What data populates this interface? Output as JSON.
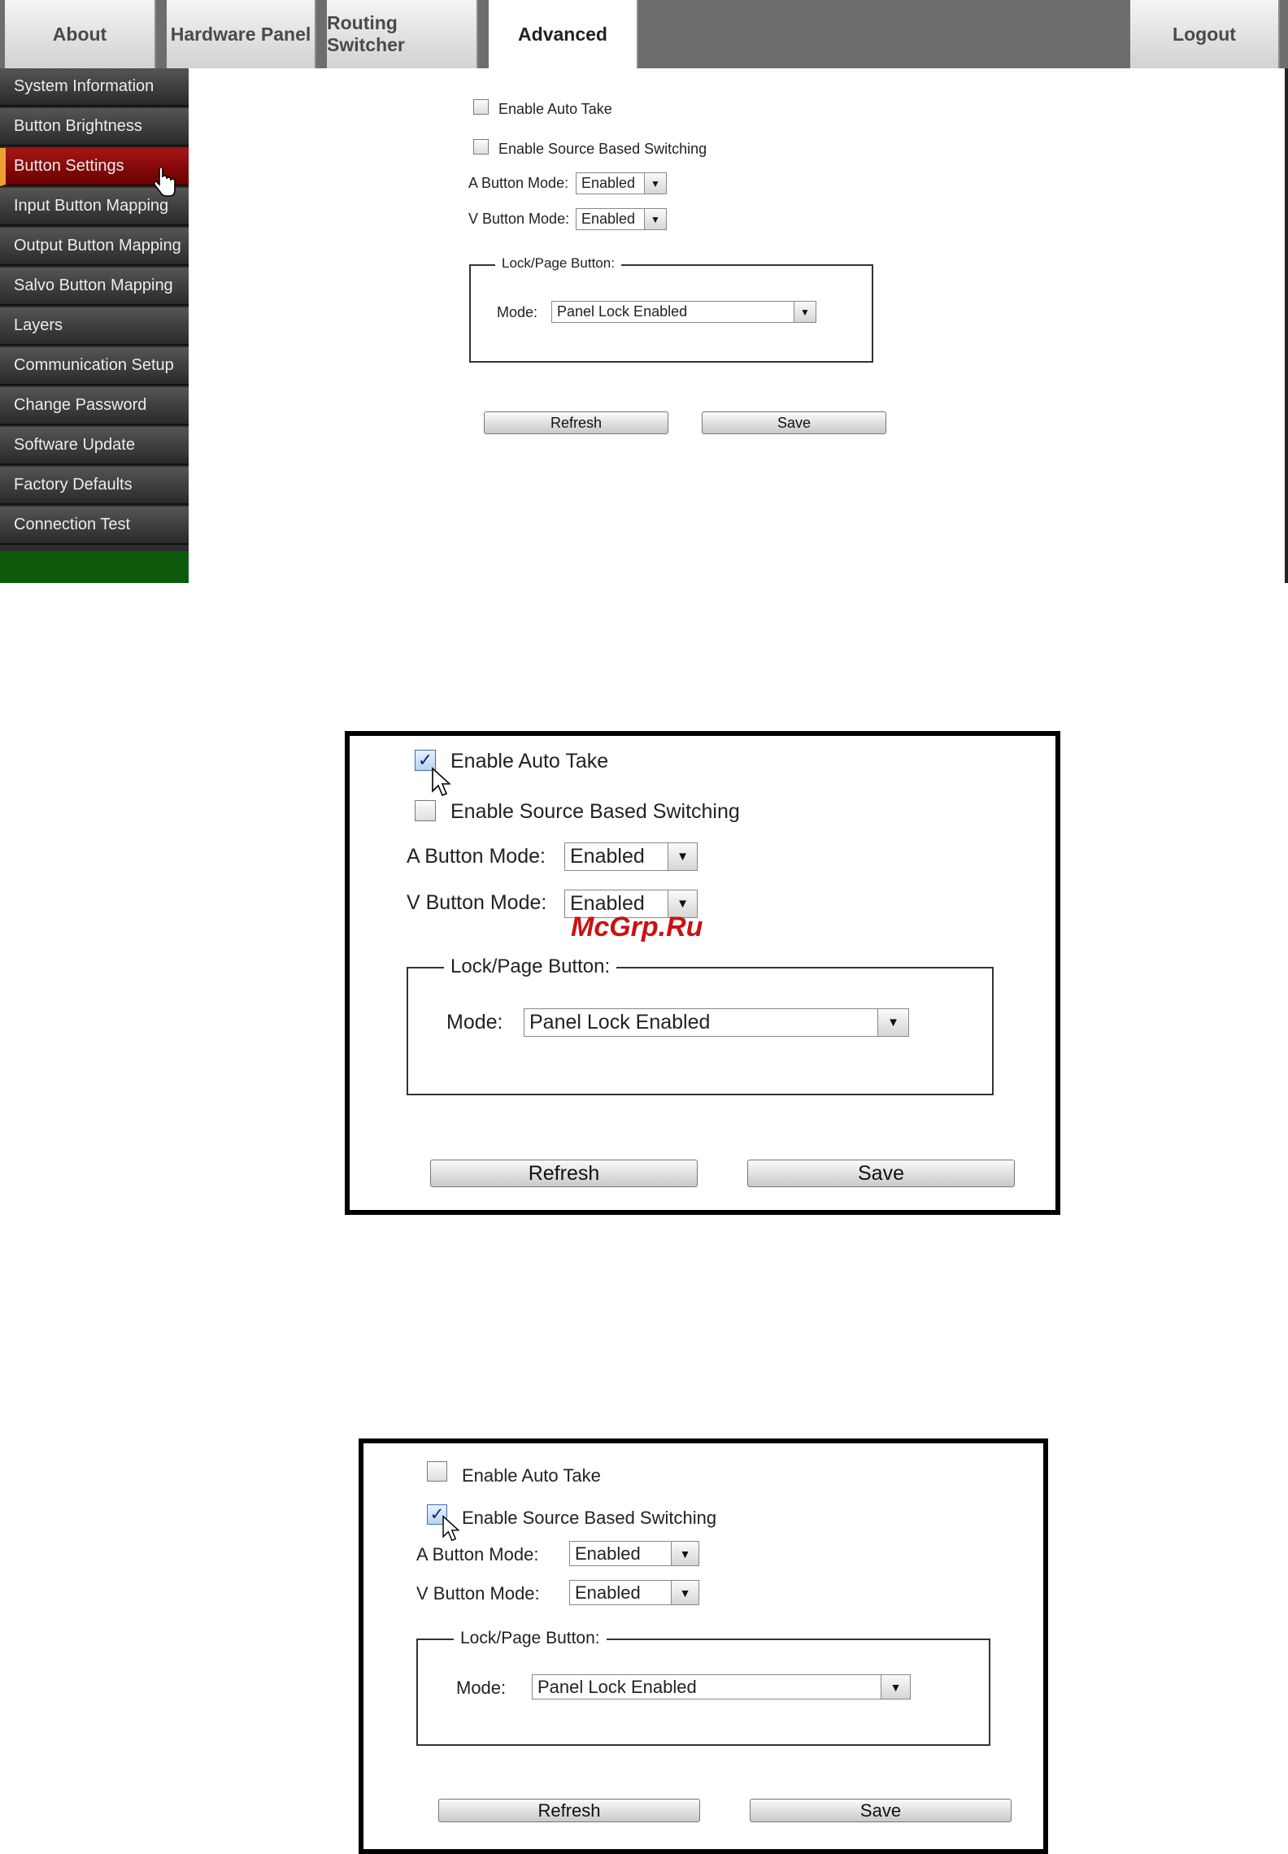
{
  "tabs": {
    "about": "About",
    "hardware_panel": "Hardware Panel",
    "routing_switcher": "Routing Switcher",
    "advanced": "Advanced",
    "logout": "Logout"
  },
  "sidebar": {
    "items": [
      {
        "label": "System Information"
      },
      {
        "label": "Button Brightness"
      },
      {
        "label": "Button Settings"
      },
      {
        "label": "Input Button Mapping"
      },
      {
        "label": "Output Button Mapping"
      },
      {
        "label": "Salvo Button Mapping"
      },
      {
        "label": "Layers"
      },
      {
        "label": "Communication Setup"
      },
      {
        "label": "Change Password"
      },
      {
        "label": "Software Update"
      },
      {
        "label": "Factory Defaults"
      },
      {
        "label": "Connection Test"
      }
    ],
    "active_item": "Button Settings"
  },
  "form": {
    "auto_take_label": "Enable Auto Take",
    "source_switching_label": "Enable Source Based Switching",
    "a_mode_label": "A Button Mode:",
    "a_mode_value": "Enabled",
    "v_mode_label": "V Button Mode:",
    "v_mode_value": "Enabled",
    "lock_legend": "Lock/Page Button:",
    "mode_label": "Mode:",
    "mode_value": "Panel Lock Enabled",
    "refresh_label": "Refresh",
    "save_label": "Save"
  },
  "panels": {
    "main": {
      "auto_take_checked": false,
      "source_switching_checked": false
    },
    "example_auto_take": {
      "auto_take_checked": true,
      "source_switching_checked": false
    },
    "example_source_switching": {
      "auto_take_checked": false,
      "source_switching_checked": true
    }
  },
  "watermark": "McGrp.Ru",
  "colors": {
    "active_tab_bg": "#ffffff",
    "topbar_bg": "#6d6d6d",
    "sidebar_active_bg": "#8a0a0a",
    "sidebar_active_accent": "#f0a030",
    "sidebar_footer": "#0d5a0d",
    "watermark": "#cc1111"
  },
  "icons": {
    "checkmark": "✓",
    "dropdown_arrow": "▼",
    "hand_cursor": "hand-pointer",
    "arrow_cursor": "arrow-pointer"
  }
}
